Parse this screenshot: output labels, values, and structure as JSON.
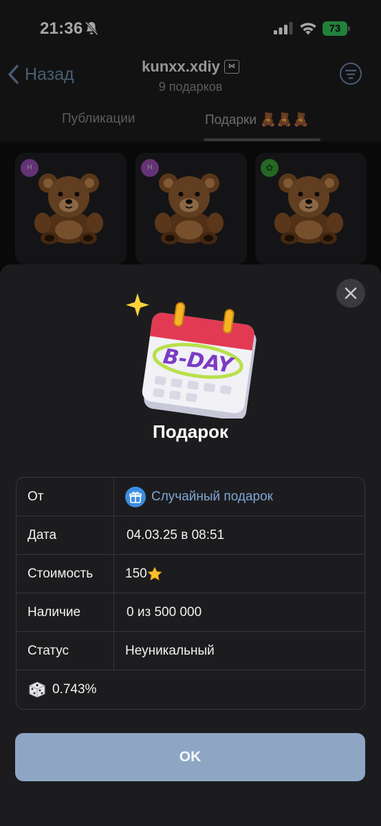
{
  "status_bar": {
    "time": "21:36",
    "battery": "73"
  },
  "header": {
    "back_label": "Назад",
    "profile_name": "kunxx.xdiy",
    "name_badge": "⋈",
    "gift_count": "9 подарков"
  },
  "tabs": [
    {
      "label": "Публикации"
    },
    {
      "label": "Подарки 🧸🧸🧸"
    }
  ],
  "gift_grid": [
    {
      "avatar_letter": "H"
    },
    {
      "avatar_letter": "H"
    },
    {
      "avatar_letter": "✿"
    }
  ],
  "modal": {
    "title": "Подарок",
    "rows": [
      {
        "label": "От",
        "value": "Случайный подарок"
      },
      {
        "label": "Дата",
        "value": "04.03.25 в 08:51"
      },
      {
        "label": "Стоимость",
        "value": "150"
      },
      {
        "label": "Наличие",
        "value": "0 из 500 000"
      },
      {
        "label": "Статус",
        "value": "Неуникальный"
      }
    ],
    "chance": "0.743%",
    "ok_label": "OK",
    "hero_text": "B-DAY"
  },
  "colors": {
    "accent_link": "#7fa7d6",
    "ok_button": "#8ea6c4",
    "sheet_bg": "#1c1c1e",
    "battery": "#34c759"
  },
  "icons": [
    "bell-off-icon",
    "signal-icon",
    "wifi-icon",
    "battery-icon",
    "chevron-left-icon",
    "filter-icon",
    "close-icon",
    "gift-icon",
    "star-icon",
    "dice-icon"
  ]
}
